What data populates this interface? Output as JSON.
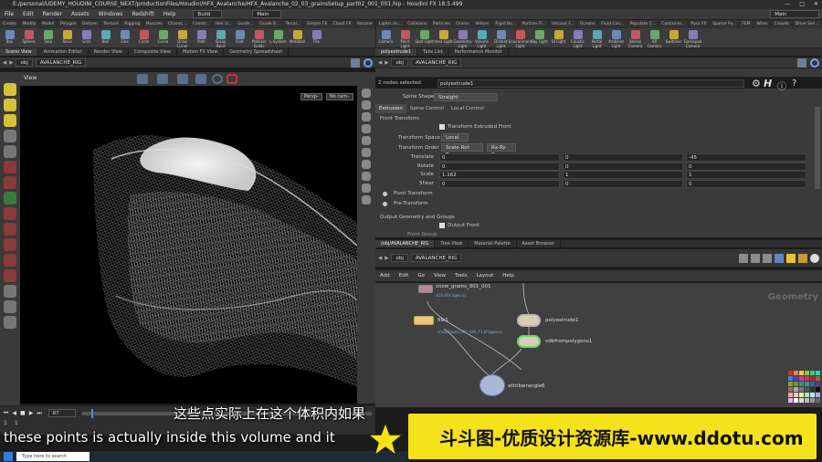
{
  "window": {
    "title": "E:/personal/UDEMY_HOUDINI_COURSE_NEXT/productionFiles/Houdini/HFX_Avalanche/HFX_Avalanche_02_03_grainsSetup_part02_001_001.hip - Houdini FX 18.5.499"
  },
  "menu": [
    "File",
    "Edit",
    "Render",
    "Assets",
    "Windows",
    "Redshift",
    "Help"
  ],
  "desktop_left": "Build",
  "desktop_right": "Main",
  "shelf_tabs_left": [
    "Create",
    "Modify",
    "Model",
    "Polygon",
    "Deform",
    "Texture",
    "Rigging",
    "Muscles",
    "Charac...",
    "Constr...",
    "Hair U...",
    "Guide...",
    "Guide B...",
    "Terrai...",
    "Simple FX",
    "Cloud FX",
    "Volume"
  ],
  "shelf_tools_left": [
    "Box",
    "Sphere",
    "Tube",
    "Torus",
    "Grid",
    "Null",
    "Line",
    "Circle",
    "Curve",
    "Draw Curve",
    "Path",
    "Spray Paint",
    "Font",
    "Platonic Solids",
    "L-System",
    "Metaball",
    "File"
  ],
  "shelf_tabs_right": [
    "Lights an...",
    "Collisions",
    "Particles",
    "Grains",
    "Vellum",
    "Rigid Bo...",
    "Particle Fl...",
    "Viscous F...",
    "Oceans",
    "Fluid Con...",
    "Populate C...",
    "Container...",
    "Pyro FX",
    "Sparse Py...",
    "FEM",
    "Wires",
    "Crowds",
    "Drive Sim..."
  ],
  "shelf_tools_right": [
    "Camera",
    "Point Light",
    "Spot Light",
    "Area Light",
    "Geometry Light",
    "Volume Light",
    "Distant Light",
    "Environment Light",
    "Sky Light",
    "GI Light",
    "Caustic Light",
    "Portal Light",
    "Ambient Light",
    "Stereo Camera",
    "VR Camera",
    "Switcher",
    "Gamepad Camera"
  ],
  "left_pane_tabs": [
    "Scene View",
    "Animation Editor",
    "Render View",
    "Composite View",
    "Motion FX View",
    "Geometry Spreadsheet"
  ],
  "left_path": {
    "ctx": "obj",
    "node": "AVALANCHE_RIG"
  },
  "viewport": {
    "label": "View",
    "persp": "Persp–",
    "cam": "No cam–"
  },
  "right_top_tabs": [
    "polyextrude1",
    "Take List",
    "Performance Monitor"
  ],
  "right_path": {
    "ctx": "obj",
    "node": "AVALANCHE_RIG"
  },
  "params": {
    "selected": "2 nodes selected",
    "node_name": "polyextrude1",
    "spine_shape_label": "Spine Shape",
    "spine_shape_value": "Straight",
    "tabs": [
      "Extrusion",
      "Spine Control",
      "Local Control"
    ],
    "section_front": "Front Transform",
    "transform_extruded_front": "Transform Extruded Front",
    "transform_space_label": "Transform Space",
    "transform_space_value": "Local",
    "transform_order_label": "Transform Order",
    "transform_order_value": "Scale Rot Trans",
    "rot_order_value": "Rx Ry Rz",
    "rows": [
      {
        "label": "Translate",
        "v": [
          "0",
          "0",
          "-45"
        ]
      },
      {
        "label": "Rotate",
        "v": [
          "0",
          "0",
          "0"
        ]
      },
      {
        "label": "Scale",
        "v": [
          "1.162",
          "1",
          "1"
        ]
      },
      {
        "label": "Shear",
        "v": [
          "0",
          "0",
          "0"
        ]
      }
    ],
    "pivot_transform": "Pivot Transform",
    "pre_transform": "Pre-Transform",
    "section_output": "Output Geometry and Groups",
    "output_front": "Output Front",
    "front_group": "Front Group"
  },
  "net_tabs": [
    "/obj/AVALANCHE_RIG",
    "Tree View",
    "Material Palette",
    "Asset Browser"
  ],
  "net_path": {
    "ctx": "obj",
    "node": "AVALANCHE_RIG"
  },
  "net_menu": [
    "Add",
    "Edit",
    "Go",
    "View",
    "Tools",
    "Layout",
    "Help"
  ],
  "network_label": "Geometry",
  "nodes": {
    "snow_grains": {
      "name": "snow_grains_001_001",
      "sub": "$US.$F4.bgeo.sc"
    },
    "file1": {
      "name": "file1",
      "sub": "snowGrains_001_004_F1.$F.bgeo.sc"
    },
    "polyextrude1": {
      "name": "polyextrude1"
    },
    "vdbfrompolygons1": {
      "name": "vdbfrompolygons1"
    },
    "attribwrangle6": {
      "name": "attribwrangle6"
    }
  },
  "timeline": {
    "frame": "67",
    "start": "1",
    "end": "1"
  },
  "subtitles": {
    "cn": "这些点实际上在这个体积内如果",
    "en": "these points is actually inside this volume and it"
  },
  "watermark": "斗斗图-优质设计资源库-www.ddotu.com",
  "taskbar_search": "Type here to search",
  "colors": {
    "accent_yellow": "#f6e21a",
    "node_yellow": "#e8c878",
    "bg": "#3a3a3a"
  }
}
